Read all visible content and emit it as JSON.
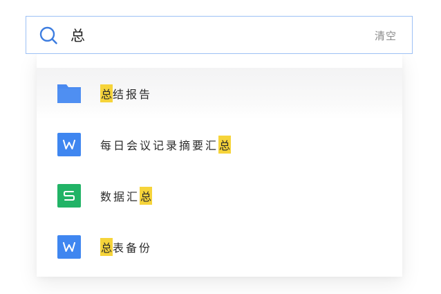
{
  "search": {
    "query": "总",
    "clear_label": "清空"
  },
  "colors": {
    "border": "#9cc0f5",
    "search_icon": "#3d7de0",
    "folder": "#4a8af0",
    "word": "#3f86f0",
    "sheet": "#21b366",
    "highlight": "#f6d43a"
  },
  "results": [
    {
      "type": "folder",
      "icon": "folder-icon",
      "prefix": "",
      "match": "总",
      "suffix": "结报告"
    },
    {
      "type": "word",
      "icon": "word-doc-icon",
      "badge": "W",
      "prefix": "每日会议记录摘要汇",
      "match": "总",
      "suffix": ""
    },
    {
      "type": "sheet",
      "icon": "spreadsheet-icon",
      "badge": "S",
      "prefix": "数据汇",
      "match": "总",
      "suffix": ""
    },
    {
      "type": "word",
      "icon": "word-doc-icon",
      "badge": "W",
      "prefix": "",
      "match": "总",
      "suffix": "表备份"
    }
  ]
}
